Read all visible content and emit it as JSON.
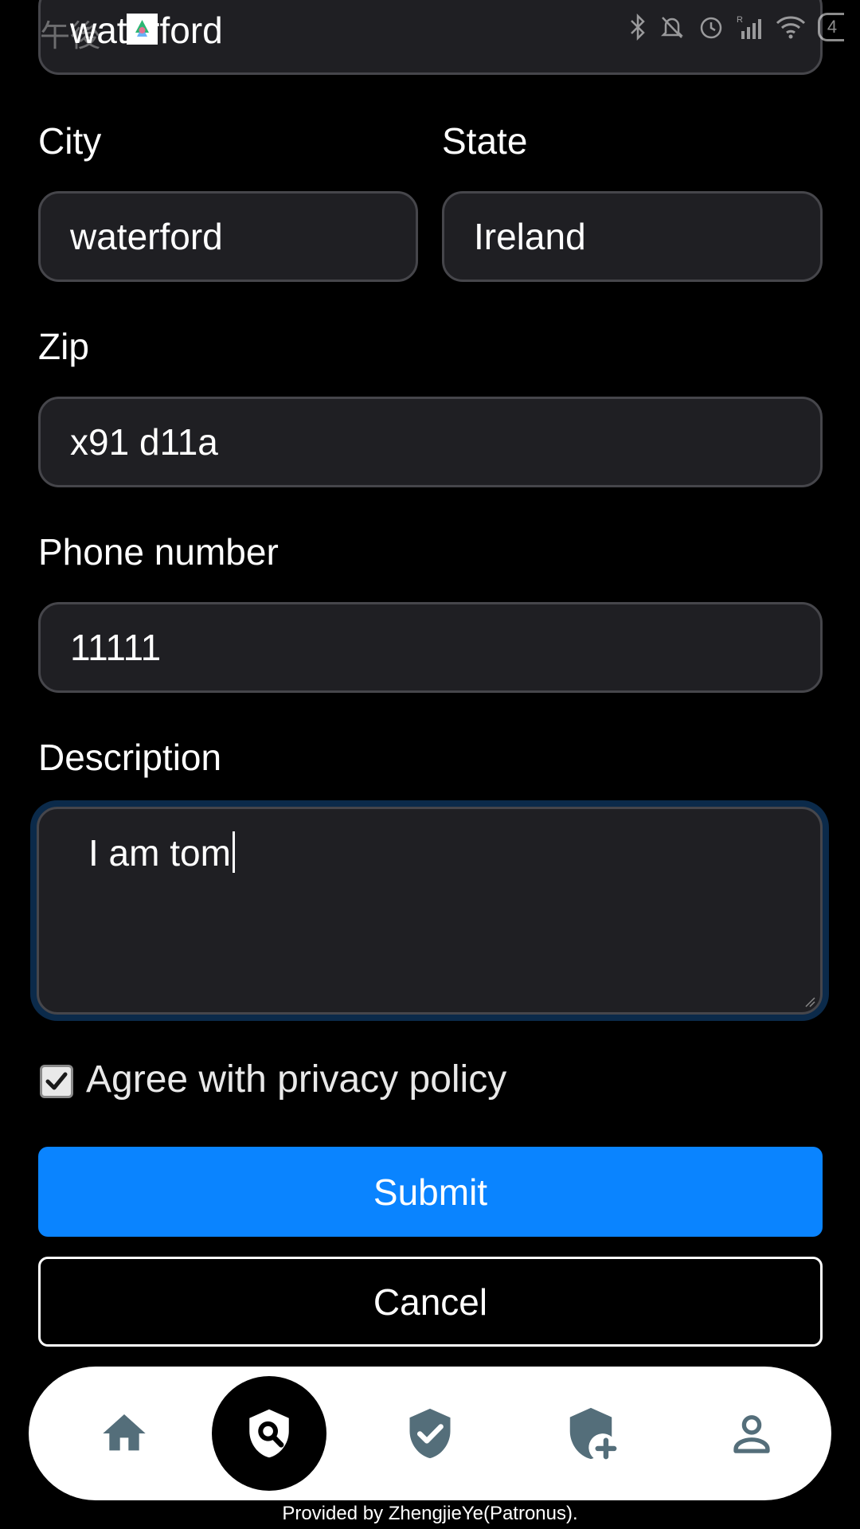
{
  "status_bar": {
    "time": "午後",
    "battery": "4"
  },
  "address_partial": {
    "value": "waterford"
  },
  "city": {
    "label": "City",
    "value": "waterford"
  },
  "state": {
    "label": "State",
    "value": "Ireland"
  },
  "zip": {
    "label": "Zip",
    "value": "x91 d11a"
  },
  "phone": {
    "label": "Phone number",
    "value": "11111"
  },
  "description": {
    "label": "Description",
    "value": "I am tom"
  },
  "privacy": {
    "label": "Agree with privacy policy",
    "checked": true
  },
  "buttons": {
    "submit": "Submit",
    "cancel": "Cancel"
  },
  "bottom_nav": {
    "items": [
      {
        "icon": "home-icon"
      },
      {
        "icon": "shield-search-icon",
        "active": true
      },
      {
        "icon": "shield-check-icon"
      },
      {
        "icon": "shield-add-icon"
      },
      {
        "icon": "person-icon"
      }
    ],
    "icon_color": "#546e7a",
    "active_bg": "#000000"
  },
  "footer": {
    "credit": "Provided by ZhengjieYe(Patronus)."
  },
  "colors": {
    "accent": "#0a84ff",
    "field_bg": "#1f1f23",
    "field_border": "#46464b",
    "page_bg": "#000000"
  }
}
